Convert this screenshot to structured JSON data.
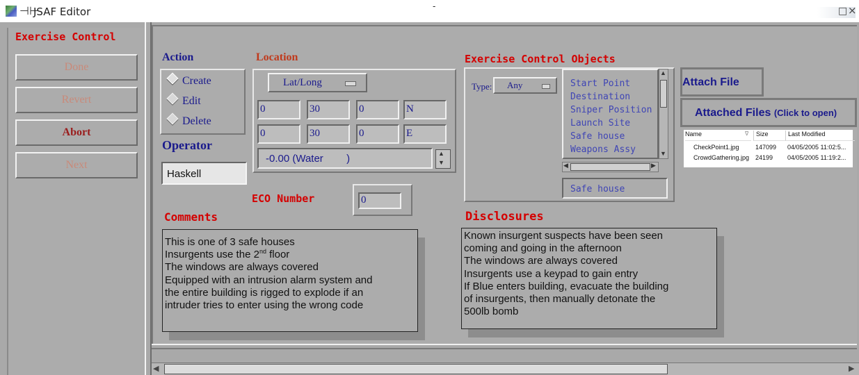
{
  "window": {
    "title": "JSAF Editor",
    "title_dash": "-"
  },
  "sidebar": {
    "title": "Exercise Control",
    "buttons": {
      "done": "Done",
      "revert": "Revert",
      "abort": "Abort",
      "next": "Next"
    }
  },
  "action": {
    "label": "Action",
    "options": [
      "Create",
      "Edit",
      "Delete"
    ],
    "selected": "Create"
  },
  "operator": {
    "label": "Operator",
    "value": "Haskell"
  },
  "location": {
    "label": "Location",
    "format": "Lat/Long",
    "lat": {
      "deg": "0",
      "min": "30",
      "sec": "0",
      "hemi": "N"
    },
    "lon": {
      "deg": "0",
      "min": "30",
      "sec": "0",
      "hemi": "E"
    },
    "elevation": "-0.00 (Water        )"
  },
  "eco_number": {
    "label": "ECO Number",
    "value": "0"
  },
  "eco_objects": {
    "label": "Exercise Control Objects",
    "type_label": "Type:",
    "type_value": "Any",
    "items": [
      "Start Point",
      "Destination",
      "Sniper Position",
      "Launch Site",
      "Safe house",
      "Weapons Assy"
    ],
    "selected": "Safe house"
  },
  "attachments": {
    "attach_label": "Attach File",
    "attached_label": "Attached Files",
    "attached_hint": "(Click to open)",
    "columns": [
      "Name",
      "Size",
      "Last Modified"
    ],
    "files": [
      {
        "name": "CheckPoint1.jpg",
        "size": "147099",
        "modified": "04/05/2005 11:02:5..."
      },
      {
        "name": "CrowdGathering.jpg",
        "size": "24199",
        "modified": "04/05/2005 11:19:2..."
      }
    ]
  },
  "comments": {
    "label": "Comments",
    "lines": [
      "This is one of 3 safe houses",
      "Insurgents use the 2",
      "nd",
      " floor",
      "The windows are always covered",
      "Equipped with an intrusion alarm system and",
      "the entire building is rigged to explode if an",
      "intruder tries to enter using the wrong code"
    ]
  },
  "disclosures": {
    "label": "Disclosures",
    "lines": [
      "Known insurgent suspects have been seen",
      "coming and going in the afternoon",
      "The windows are always covered",
      "Insurgents use a keypad to gain entry",
      "If Blue enters building, evacuate the building",
      "of insurgents, then manually detonate the",
      "500lb bomb"
    ]
  },
  "icons": {
    "pin": "⊣⊢",
    "restore": "□",
    "close": "⨯",
    "sort": "∇"
  }
}
